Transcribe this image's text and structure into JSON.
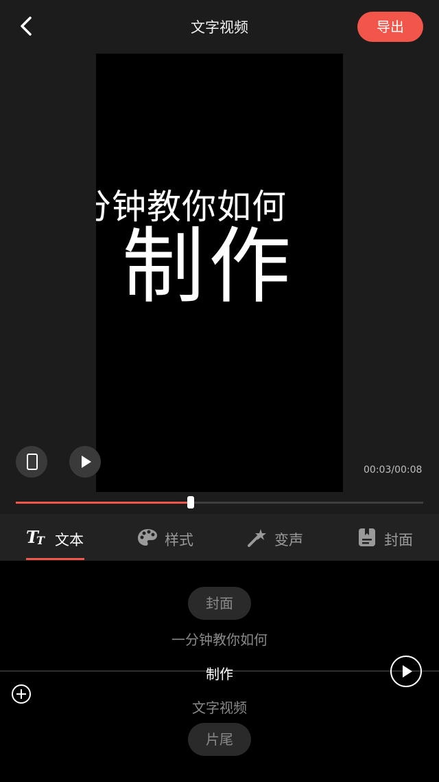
{
  "header": {
    "title": "文字视频",
    "export_label": "导出",
    "back_icon": "chevron-left-icon"
  },
  "preview": {
    "line1": "分钟教你如何",
    "line2": "制作",
    "time_readout": "00:03/00:08",
    "progress": 0.43,
    "device_icon": "phone-icon",
    "play_icon": "play-icon"
  },
  "tabs": [
    {
      "label": "文本",
      "icon": "text-format-icon",
      "active": true
    },
    {
      "label": "样式",
      "icon": "palette-icon",
      "active": false
    },
    {
      "label": "变声",
      "icon": "magic-wand-icon",
      "active": false
    },
    {
      "label": "封面",
      "icon": "cover-icon",
      "active": false
    }
  ],
  "segments": {
    "top_pill": "封面",
    "items": [
      "一分钟教你如何",
      "制作",
      "文字视频"
    ],
    "current_index": 1,
    "bottom_pill": "片尾"
  },
  "colors": {
    "accent": "#f2564b",
    "background": "#1c1c1c",
    "list_background": "#000000"
  }
}
